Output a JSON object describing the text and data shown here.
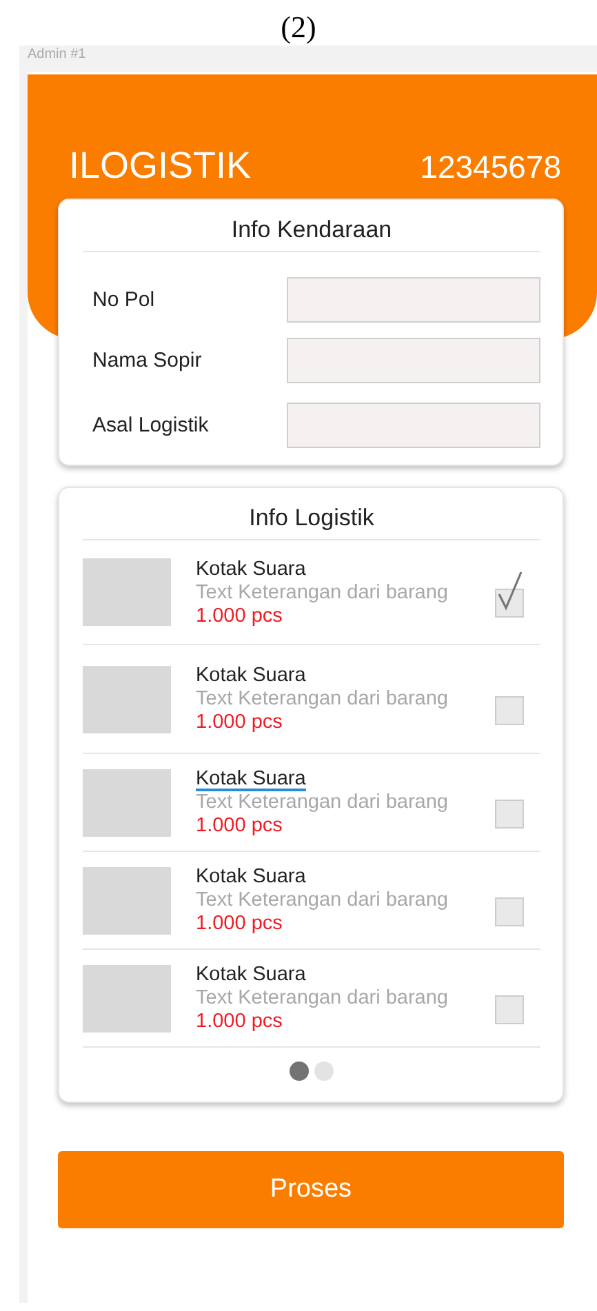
{
  "caption": "(2)",
  "frame_label": "Admin #1",
  "header": {
    "title": "ILOGISTIK",
    "number": "12345678"
  },
  "vehicle_card": {
    "title": "Info Kendaraan",
    "fields": [
      {
        "label": "No Pol"
      },
      {
        "label": "Nama Sopir"
      },
      {
        "label": "Asal Logistik"
      }
    ]
  },
  "logistics_card": {
    "title": "Info Logistik",
    "items": [
      {
        "name": "Kotak Suara",
        "description": "Text Keterangan dari barang",
        "quantity": "1.000 pcs",
        "checked": true,
        "underlined": false
      },
      {
        "name": "Kotak Suara",
        "description": "Text Keterangan dari barang",
        "quantity": "1.000 pcs",
        "checked": false,
        "underlined": false
      },
      {
        "name": "Kotak Suara",
        "description": "Text Keterangan dari barang",
        "quantity": "1.000 pcs",
        "checked": false,
        "underlined": true
      },
      {
        "name": "Kotak Suara",
        "description": "Text Keterangan dari barang",
        "quantity": "1.000 pcs",
        "checked": false,
        "underlined": false
      },
      {
        "name": "Kotak Suara",
        "description": "Text Keterangan dari barang",
        "quantity": "1.000 pcs",
        "checked": false,
        "underlined": false
      }
    ],
    "pages": [
      {
        "selected": true
      },
      {
        "selected": false
      }
    ]
  },
  "button": "Proses"
}
